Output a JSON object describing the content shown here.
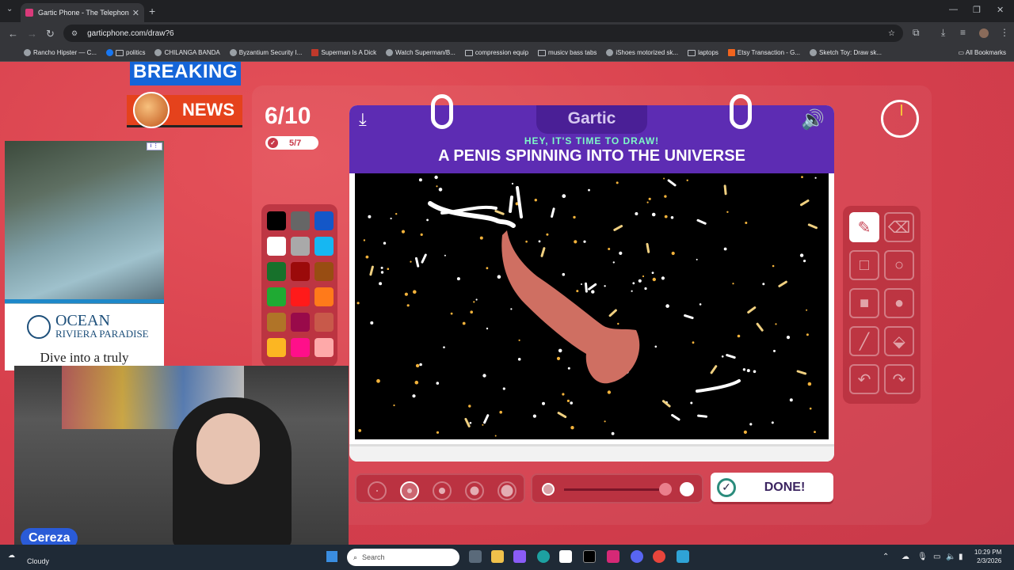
{
  "browser": {
    "tab_title": "Gartic Phone - The Telephone G",
    "url": "garticphone.com/draw?6",
    "bookmarks": [
      "Rancho Hipster — C...",
      "politics",
      "CHILANGA BANDA",
      "Byzantium Security I...",
      "Superman Is A Dick",
      "Watch Superman/B...",
      "compression equip",
      "musicv bass tabs",
      "iShoes motorized sk...",
      "laptops",
      "Etsy Transaction - G...",
      "Sketch Toy: Draw sk..."
    ],
    "all_bookmarks": "All Bookmarks"
  },
  "overlay": {
    "breaking": "BREAKING",
    "news": "NEWS"
  },
  "ad": {
    "brand": "OCEAN",
    "sub": "RIVIERA PARADISE",
    "cta": "Dive into a truly"
  },
  "game": {
    "round": "6/10",
    "done_count": "5/7",
    "logo": "Gartic",
    "kicker": "HEY, IT'S TIME TO DRAW!",
    "prompt": "A PENIS SPINNING INTO THE UNIVERSE",
    "done_label": "DONE!",
    "palette": [
      "#000000",
      "#666666",
      "#1457c8",
      "#ffffff",
      "#a9a9a9",
      "#16b7f2",
      "#17712b",
      "#9b0a0a",
      "#984d12",
      "#1faa33",
      "#ff1a1a",
      "#ff7a1a",
      "#b07428",
      "#990a4a",
      "#c8594a",
      "#fcb622",
      "#ff0f8a",
      "#fea9a9"
    ],
    "selected_tool": "pencil",
    "brush_size_selected": 2,
    "opacity": 1.0
  },
  "webcam": {
    "name": "Cereza"
  },
  "taskbar": {
    "weather": "Cloudy",
    "search_placeholder": "Search",
    "time": "10:29 PM",
    "date": "2/3/2026"
  }
}
